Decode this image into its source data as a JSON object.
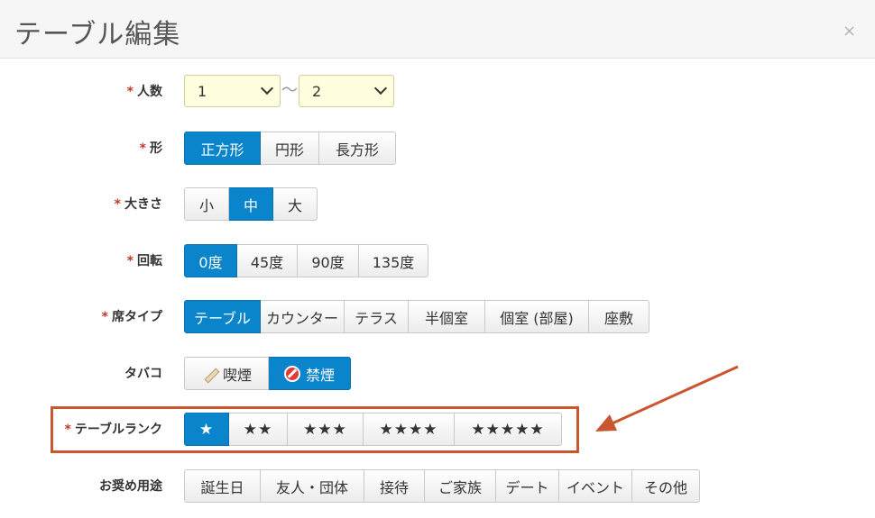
{
  "header": {
    "title": "テーブル編集",
    "close_label": "×"
  },
  "form": {
    "required_mark": "*",
    "people": {
      "label": "人数",
      "min_value": "1",
      "max_value": "2",
      "separator": "〜"
    },
    "shape": {
      "label": "形",
      "options": [
        "正方形",
        "円形",
        "長方形"
      ],
      "selected": "正方形"
    },
    "size": {
      "label": "大きさ",
      "options": [
        "小",
        "中",
        "大"
      ],
      "selected": "中"
    },
    "rotation": {
      "label": "回転",
      "options": [
        "0度",
        "45度",
        "90度",
        "135度"
      ],
      "selected": "0度"
    },
    "seat_type": {
      "label": "席タイプ",
      "options": [
        "テーブル",
        "カウンター",
        "テラス",
        "半個室",
        "個室 (部屋)",
        "座敷"
      ],
      "selected": "テーブル"
    },
    "tobacco": {
      "label": "タバコ",
      "options": [
        "喫煙",
        "禁煙"
      ],
      "selected": "禁煙",
      "icons": [
        "cigarette-icon",
        "no-smoking-icon"
      ]
    },
    "table_rank": {
      "label": "テーブルランク",
      "options": [
        "★",
        "★★",
        "★★★",
        "★★★★",
        "★★★★★"
      ],
      "selected": "★"
    },
    "purpose": {
      "label": "お奨め用途",
      "options": [
        "誕生日",
        "友人・団体",
        "接待",
        "ご家族",
        "デート",
        "イベント",
        "その他"
      ]
    }
  },
  "annotation": {
    "color": "#c9562f"
  },
  "colors": {
    "active": "#0a85cc",
    "select_bg": "#ffffdf"
  }
}
